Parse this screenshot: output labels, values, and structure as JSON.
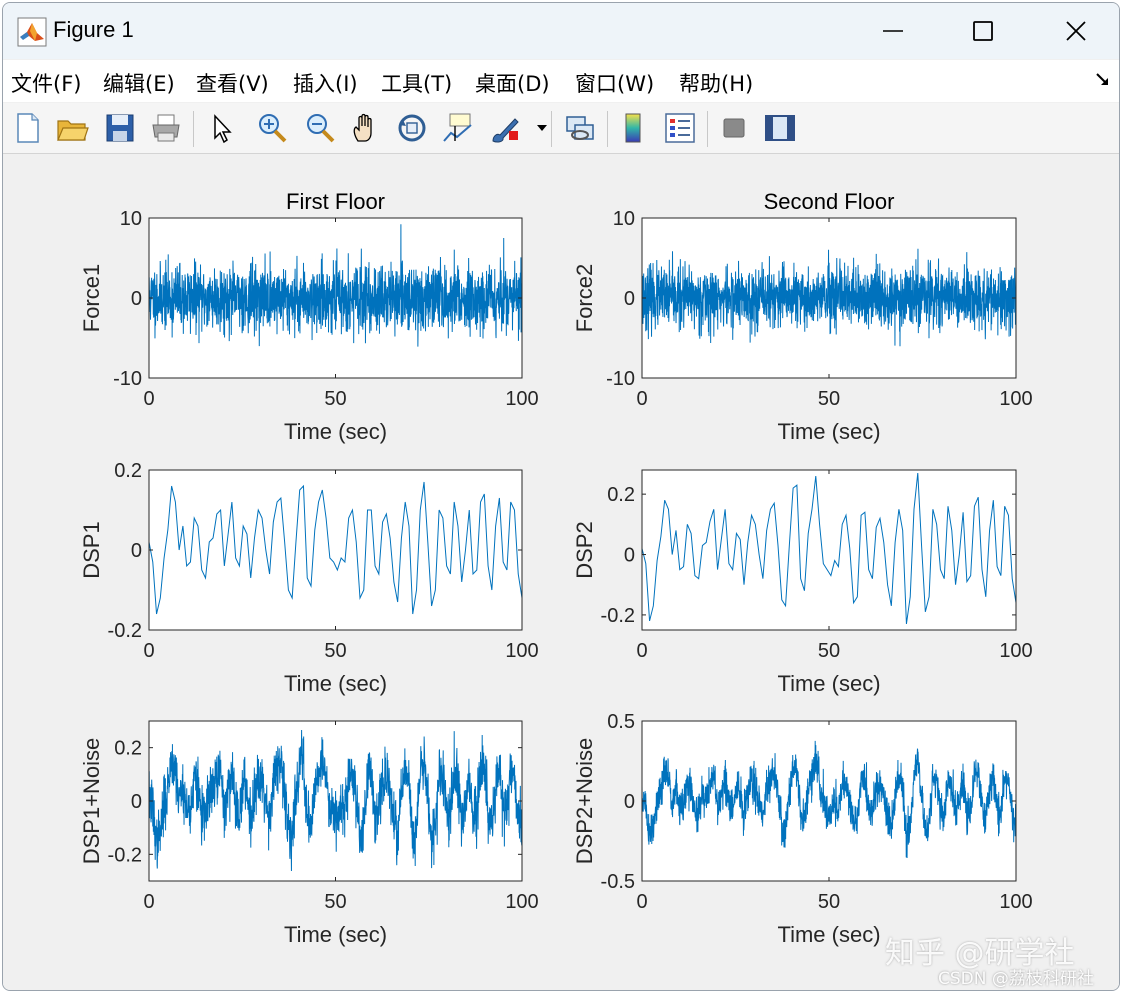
{
  "window": {
    "title": "Figure 1"
  },
  "menu": {
    "items": [
      "文件(F)",
      "编辑(E)",
      "查看(V)",
      "插入(I)",
      "工具(T)",
      "桌面(D)",
      "窗口(W)",
      "帮助(H)"
    ]
  },
  "toolbar": {
    "icons": [
      "new-figure-icon",
      "open-folder-icon",
      "save-icon",
      "print-icon",
      "select-pointer-icon",
      "zoom-in-icon",
      "zoom-out-icon",
      "pan-hand-icon",
      "rotate-3d-icon",
      "data-cursor-icon",
      "brush-icon",
      "link-plot-icon",
      "colorbar-icon",
      "legend-icon",
      "hide-plot-tools-icon",
      "show-plot-tools-icon"
    ]
  },
  "colors": {
    "line": "#0072BD",
    "axes_bg": "#ffffff",
    "figure_bg": "#f0f0f0"
  },
  "watermark": {
    "line1": "知乎 @研学社",
    "line2": "CSDN @荔枝科研社"
  },
  "chart_data": [
    {
      "type": "line",
      "panel": "force1",
      "title": "First Floor",
      "xlabel": "Time (sec)",
      "ylabel": "Force1",
      "xlim": [
        0,
        100
      ],
      "ylim": [
        -10,
        10
      ],
      "xticks": [
        0,
        50,
        100
      ],
      "yticks": [
        10,
        0,
        -10
      ],
      "xtick_labels": [
        "0",
        "50",
        "100"
      ],
      "ytick_labels": [
        "10",
        "0",
        "-10"
      ],
      "signal": {
        "kind": "white-noise",
        "std": 2.0,
        "n": 2000,
        "seed": 11
      }
    },
    {
      "type": "line",
      "panel": "force2",
      "title": "Second Floor",
      "xlabel": "Time (sec)",
      "ylabel": "Force2",
      "xlim": [
        0,
        100
      ],
      "ylim": [
        -10,
        10
      ],
      "xticks": [
        0,
        50,
        100
      ],
      "yticks": [
        10,
        0,
        -10
      ],
      "xtick_labels": [
        "0",
        "50",
        "100"
      ],
      "ytick_labels": [
        "10",
        "0",
        "-10"
      ],
      "signal": {
        "kind": "white-noise",
        "std": 1.9,
        "n": 2000,
        "seed": 23
      }
    },
    {
      "type": "line",
      "panel": "dsp1",
      "title": "",
      "xlabel": "Time (sec)",
      "ylabel": "DSP1",
      "xlim": [
        0,
        100
      ],
      "ylim": [
        -0.2,
        0.2
      ],
      "xticks": [
        0,
        50,
        100
      ],
      "yticks": [
        0.2,
        0,
        -0.2
      ],
      "xtick_labels": [
        "0",
        "50",
        "100"
      ],
      "ytick_labels": [
        "0.2",
        "0",
        "-0.2"
      ],
      "values": [
        0.02,
        -0.03,
        -0.16,
        -0.12,
        -0.02,
        0.05,
        0.16,
        0.12,
        0.0,
        0.06,
        -0.04,
        -0.03,
        0.08,
        0.06,
        -0.05,
        -0.07,
        0.02,
        0.03,
        0.09,
        0.1,
        -0.04,
        0.04,
        0.12,
        -0.02,
        -0.04,
        0.06,
        0.04,
        -0.07,
        0.03,
        0.1,
        0.08,
        0.0,
        -0.06,
        0.07,
        0.12,
        0.13,
        0.02,
        -0.1,
        -0.12,
        0.02,
        0.15,
        0.16,
        -0.07,
        -0.09,
        0.05,
        0.12,
        0.15,
        0.08,
        -0.02,
        -0.03,
        -0.05,
        -0.02,
        -0.03,
        0.08,
        0.1,
        0.02,
        -0.12,
        -0.1,
        0.1,
        0.1,
        -0.04,
        -0.06,
        0.07,
        0.09,
        0.03,
        -0.08,
        -0.13,
        0.03,
        0.12,
        0.06,
        -0.16,
        -0.1,
        0.1,
        0.17,
        0.02,
        -0.14,
        -0.1,
        0.1,
        0.08,
        -0.04,
        -0.06,
        0.12,
        0.06,
        -0.08,
        0.0,
        0.1,
        -0.06,
        -0.05,
        0.12,
        0.14,
        -0.04,
        -0.1,
        0.06,
        0.13,
        -0.03,
        -0.05,
        0.12,
        0.1,
        -0.06,
        -0.12
      ]
    },
    {
      "type": "line",
      "panel": "dsp2",
      "title": "",
      "xlabel": "Time (sec)",
      "ylabel": "DSP2",
      "xlim": [
        0,
        100
      ],
      "ylim": [
        -0.25,
        0.28
      ],
      "xticks": [
        0,
        50,
        100
      ],
      "yticks": [
        0.2,
        0,
        -0.2
      ],
      "xtick_labels": [
        "0",
        "50",
        "100"
      ],
      "ytick_labels": [
        "0.2",
        "0",
        "-0.2"
      ],
      "values": [
        0.02,
        -0.03,
        -0.22,
        -0.17,
        -0.02,
        0.06,
        0.18,
        0.15,
        0.0,
        0.08,
        -0.05,
        -0.04,
        0.1,
        0.07,
        -0.07,
        -0.08,
        0.03,
        0.04,
        0.11,
        0.15,
        -0.05,
        0.05,
        0.15,
        -0.03,
        -0.05,
        0.07,
        0.05,
        -0.1,
        0.04,
        0.13,
        0.1,
        0.0,
        -0.08,
        0.08,
        0.15,
        0.17,
        0.03,
        -0.15,
        -0.17,
        0.03,
        0.22,
        0.23,
        -0.08,
        -0.12,
        0.07,
        0.15,
        0.26,
        0.1,
        -0.03,
        -0.05,
        -0.07,
        -0.02,
        -0.04,
        0.1,
        0.13,
        0.02,
        -0.16,
        -0.14,
        0.13,
        0.14,
        -0.05,
        -0.08,
        0.09,
        0.12,
        0.04,
        -0.1,
        -0.17,
        0.04,
        0.15,
        0.08,
        -0.23,
        -0.14,
        0.15,
        0.27,
        0.03,
        -0.19,
        -0.14,
        0.15,
        0.1,
        -0.05,
        -0.08,
        0.16,
        0.08,
        -0.1,
        0.0,
        0.14,
        -0.09,
        -0.07,
        0.16,
        0.19,
        -0.05,
        -0.14,
        0.08,
        0.18,
        -0.04,
        -0.07,
        0.16,
        0.13,
        -0.08,
        -0.16
      ]
    },
    {
      "type": "line",
      "panel": "dsp1_noise",
      "title": "",
      "xlabel": "Time (sec)",
      "ylabel": "DSP1+Noise",
      "xlim": [
        0,
        100
      ],
      "ylim": [
        -0.3,
        0.3
      ],
      "xticks": [
        0,
        50,
        100
      ],
      "yticks": [
        0.2,
        0,
        -0.2
      ],
      "xtick_labels": [
        "0",
        "50",
        "100"
      ],
      "ytick_labels": [
        "0.2",
        "0",
        "-0.2"
      ],
      "signal": {
        "kind": "base-plus-noise",
        "base_panel": 2,
        "noise_std": 0.05,
        "n": 1800,
        "seed": 37
      }
    },
    {
      "type": "line",
      "panel": "dsp2_noise",
      "title": "",
      "xlabel": "Time (sec)",
      "ylabel": "DSP2+Noise",
      "xlim": [
        0,
        100
      ],
      "ylim": [
        -0.5,
        0.5
      ],
      "xticks": [
        0,
        50,
        100
      ],
      "yticks": [
        0.5,
        0,
        -0.5
      ],
      "xtick_labels": [
        "0",
        "50",
        "100"
      ],
      "ytick_labels": [
        "0.5",
        "0",
        "-0.5"
      ],
      "signal": {
        "kind": "base-plus-noise",
        "base_panel": 3,
        "noise_std": 0.06,
        "n": 1800,
        "seed": 51
      }
    }
  ]
}
